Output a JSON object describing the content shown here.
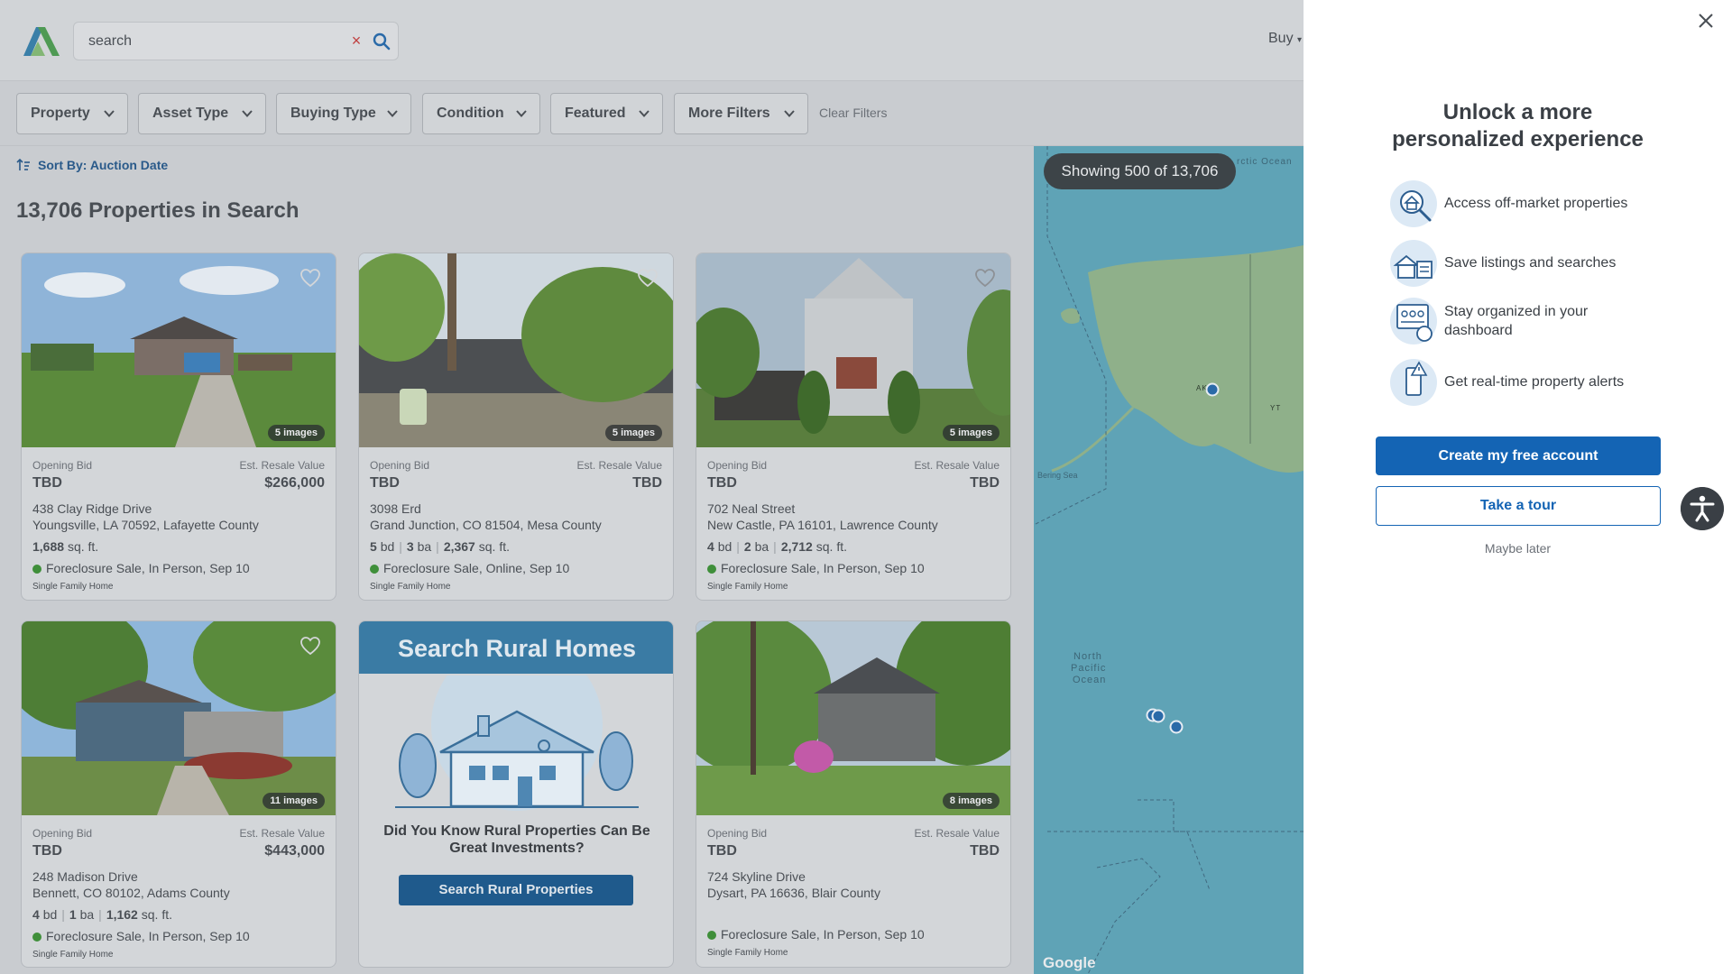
{
  "header": {
    "search_value": "search",
    "clear_icon": "×",
    "buy_label": "Buy"
  },
  "filters": {
    "items": [
      "Property",
      "Asset Type",
      "Buying Type",
      "Condition",
      "Featured",
      "More Filters"
    ],
    "clear_label": "Clear Filters"
  },
  "listing": {
    "sort_label": "Sort By: Auction Date",
    "count_title": "13,706 Properties in Search"
  },
  "cards": [
    {
      "images": "5 images",
      "opening_bid_label": "Opening Bid",
      "opening_bid": "TBD",
      "resale_label": "Est. Resale Value",
      "resale": "$266,000",
      "street": "438 Clay Ridge Drive",
      "city": "Youngsville, LA 70592, Lafayette County",
      "specs": [
        {
          "n": "1,688",
          "u": "sq. ft."
        }
      ],
      "sale": "Foreclosure Sale, In Person, Sep 10",
      "type": "Single Family Home"
    },
    {
      "images": "5 images",
      "opening_bid_label": "Opening Bid",
      "opening_bid": "TBD",
      "resale_label": "Est. Resale Value",
      "resale": "TBD",
      "street": "3098 Erd",
      "city": "Grand Junction, CO 81504, Mesa County",
      "specs": [
        {
          "n": "5",
          "u": "bd"
        },
        {
          "n": "3",
          "u": "ba"
        },
        {
          "n": "2,367",
          "u": "sq. ft."
        }
      ],
      "sale": "Foreclosure Sale, Online, Sep 10",
      "type": "Single Family Home"
    },
    {
      "images": "5 images",
      "opening_bid_label": "Opening Bid",
      "opening_bid": "TBD",
      "resale_label": "Est. Resale Value",
      "resale": "TBD",
      "street": "702 Neal Street",
      "city": "New Castle, PA 16101, Lawrence County",
      "specs": [
        {
          "n": "4",
          "u": "bd"
        },
        {
          "n": "2",
          "u": "ba"
        },
        {
          "n": "2,712",
          "u": "sq. ft."
        }
      ],
      "sale": "Foreclosure Sale, In Person, Sep 10",
      "type": "Single Family Home"
    },
    {
      "images": "11 images",
      "opening_bid_label": "Opening Bid",
      "opening_bid": "TBD",
      "resale_label": "Est. Resale Value",
      "resale": "$443,000",
      "street": "248 Madison Drive",
      "city": "Bennett, CO 80102, Adams County",
      "specs": [
        {
          "n": "4",
          "u": "bd"
        },
        {
          "n": "1",
          "u": "ba"
        },
        {
          "n": "1,162",
          "u": "sq. ft."
        }
      ],
      "sale": "Foreclosure Sale, In Person, Sep 10",
      "type": "Single Family Home"
    },
    {
      "images": "8 images",
      "opening_bid_label": "Opening Bid",
      "opening_bid": "TBD",
      "resale_label": "Est. Resale Value",
      "resale": "TBD",
      "street": "724 Skyline Drive",
      "city": "Dysart, PA 16636, Blair County",
      "specs": [],
      "sale": "Foreclosure Sale, In Person, Sep 10",
      "type": "Single Family Home"
    }
  ],
  "promo": {
    "banner": "Search Rural Homes",
    "question": "Did You Know Rural Properties Can Be Great Investments?",
    "button": "Search Rural Properties"
  },
  "map": {
    "showing": "Showing 500 of 13,706",
    "labels": {
      "arctic": "rctic Ocean",
      "ak": "AK",
      "yt": "YT",
      "bering": "Bering Sea",
      "pacific1": "North",
      "pacific2": "Pacific",
      "pacific3": "Ocean"
    },
    "attribution": "Google"
  },
  "panel": {
    "title_line1": "Unlock a more",
    "title_line2": "personalized experience",
    "features": [
      {
        "icon": "search-house-icon",
        "text": "Access off-market properties"
      },
      {
        "icon": "saved-houses-icon",
        "text": "Save listings and searches"
      },
      {
        "icon": "dashboard-icon",
        "text": "Stay organized in your dashboard"
      },
      {
        "icon": "phone-alert-icon",
        "text": "Get real-time property alerts"
      }
    ],
    "primary_button": "Create my free account",
    "secondary_button": "Take a tour",
    "later": "Maybe later"
  },
  "colors": {
    "primary": "#1464b4",
    "map_water": "#5fa3b6",
    "sale_dot": "#3f8f3a",
    "promo_banner": "#3a7ba4"
  }
}
